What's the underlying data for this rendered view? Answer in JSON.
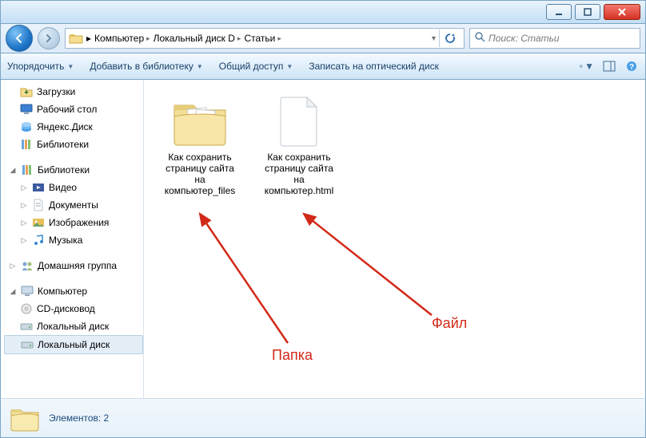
{
  "titlebar": {},
  "address": {
    "crumbs": [
      "Компьютер",
      "Локальный диск D",
      "Статьи"
    ],
    "search_placeholder": "Поиск: Статьи"
  },
  "toolbar": {
    "organize": "Упорядочить",
    "include": "Добавить в библиотеку",
    "share": "Общий доступ",
    "burn": "Записать на оптический диск"
  },
  "tree": {
    "downloads": "Загрузки",
    "desktop": "Рабочий стол",
    "yadisk": "Яндекс.Диск",
    "libs1": "Библиотеки",
    "libs2": "Библиотеки",
    "video": "Видео",
    "docs": "Документы",
    "images": "Изображения",
    "music": "Музыка",
    "homegroup": "Домашняя группа",
    "computer": "Компьютер",
    "cdrom": "CD-дисковод",
    "drive1": "Локальный диск",
    "drive2": "Локальный диск"
  },
  "files": {
    "folder_name": "Как сохранить страницу сайта на компьютер_files",
    "file_name": "Как сохранить страницу сайта на компьютер.html"
  },
  "annotations": {
    "folder_label": "Папка",
    "file_label": "Файл"
  },
  "status": {
    "text": "Элементов: 2"
  }
}
